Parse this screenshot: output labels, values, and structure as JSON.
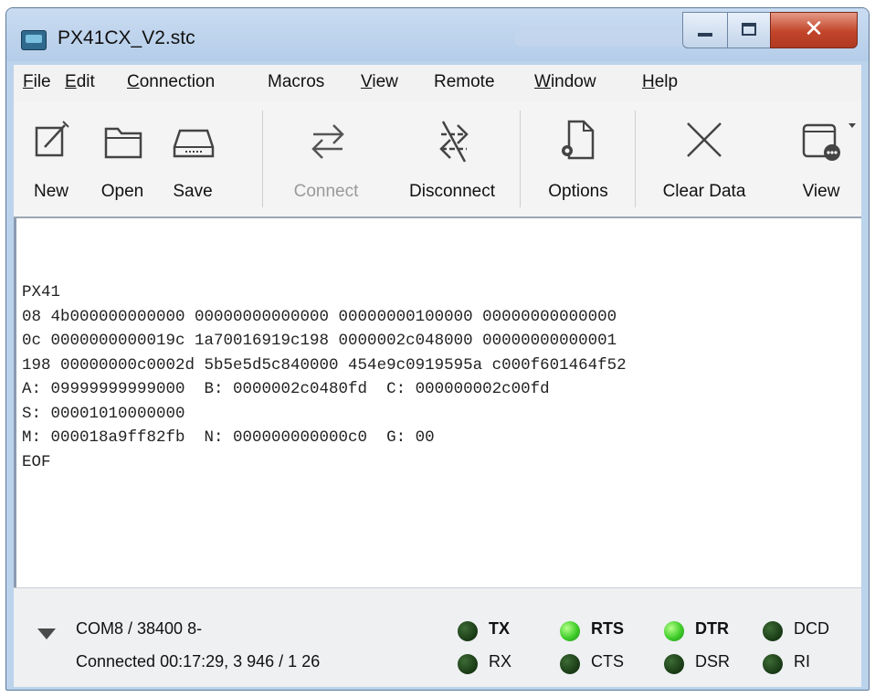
{
  "window": {
    "title": "PX41CX_V2.stc"
  },
  "menu": {
    "items": [
      {
        "first": "F",
        "rest": "ile"
      },
      {
        "first": "E",
        "rest": "dit"
      },
      {
        "first": "C",
        "rest": "onnection"
      },
      {
        "first": "",
        "rest": "Macros"
      },
      {
        "first": "V",
        "rest": "iew"
      },
      {
        "first": "",
        "rest": "Remote"
      },
      {
        "first": "W",
        "rest": "indow"
      },
      {
        "first": "H",
        "rest": "elp"
      }
    ]
  },
  "toolbar": {
    "new": "New",
    "open": "Open",
    "save": "Save",
    "connect": "Connect",
    "disconnect": "Disconnect",
    "options": "Options",
    "clear": "Clear Data",
    "view": "View"
  },
  "terminal": {
    "lines": [
      "PX41",
      "08 4b000000000000 00000000000000 00000000100000 00000000000000",
      "0c 0000000000019c 1a70016919c198 0000002c048000 00000000000001",
      "198 00000000c0002d 5b5e5d5c840000 454e9c0919595a c000f601464f52",
      "A: 09999999999000  B: 0000002c0480fd  C: 000000002c00fd",
      "S: 00001010000000",
      "M: 000018a9ff82fb  N: 000000000000c0  G: 00",
      "EOF"
    ]
  },
  "status": {
    "port": "COM8 / 38400 8-",
    "connection": "Connected 00:17:29, 3 946 / 1 26"
  },
  "signals": {
    "tx": {
      "label": "TX",
      "state": "off"
    },
    "rx": {
      "label": "RX",
      "state": "off"
    },
    "rts": {
      "label": "RTS",
      "state": "on"
    },
    "cts": {
      "label": "CTS",
      "state": "off"
    },
    "dtr": {
      "label": "DTR",
      "state": "on"
    },
    "dsr": {
      "label": "DSR",
      "state": "off"
    },
    "dcd": {
      "label": "DCD",
      "state": "off"
    },
    "ri": {
      "label": "RI",
      "state": "off"
    }
  },
  "colors": {
    "led_on": "#3fcc2a",
    "led_off": "#1f4a1a",
    "close_button": "#c2442a"
  }
}
